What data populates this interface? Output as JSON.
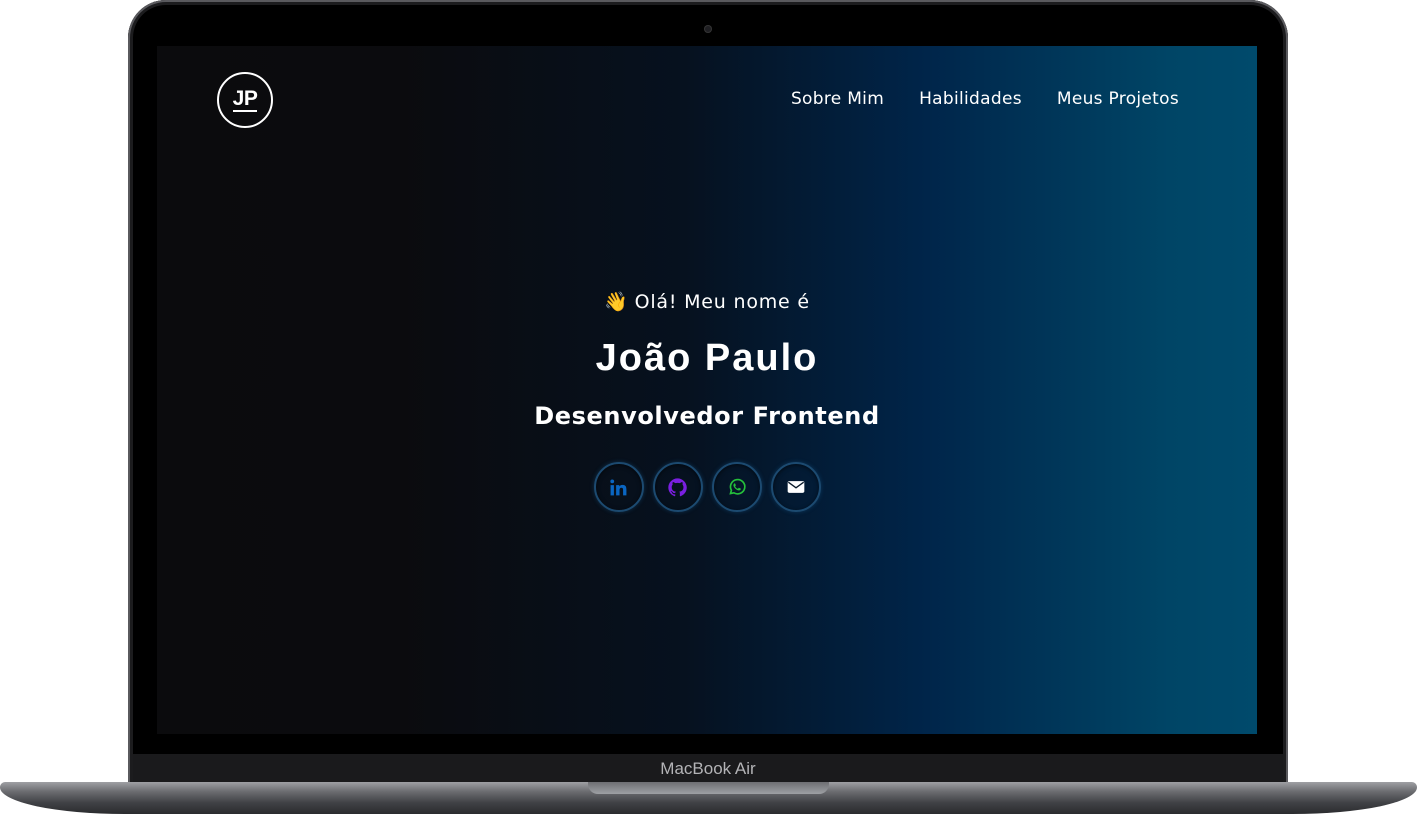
{
  "device": {
    "label": "MacBook Air"
  },
  "header": {
    "logo_text": "JP",
    "nav": [
      {
        "label": "Sobre Mim"
      },
      {
        "label": "Habilidades"
      },
      {
        "label": "Meus Projetos"
      }
    ]
  },
  "hero": {
    "wave_emoji": "👋",
    "greeting": "Olá! Meu nome é",
    "name": "João Paulo",
    "role": "Desenvolvedor Frontend"
  },
  "socials": [
    {
      "icon": "linkedin-icon",
      "color": "#0a66c2"
    },
    {
      "icon": "github-icon",
      "color": "#7a1fe0"
    },
    {
      "icon": "whatsapp-icon",
      "color": "#25c03b"
    },
    {
      "icon": "envelope-icon",
      "color": "#ffffff"
    }
  ],
  "colors": {
    "gradient_start": "#0b0b0d",
    "gradient_end": "#004a6c",
    "text": "#ffffff"
  }
}
